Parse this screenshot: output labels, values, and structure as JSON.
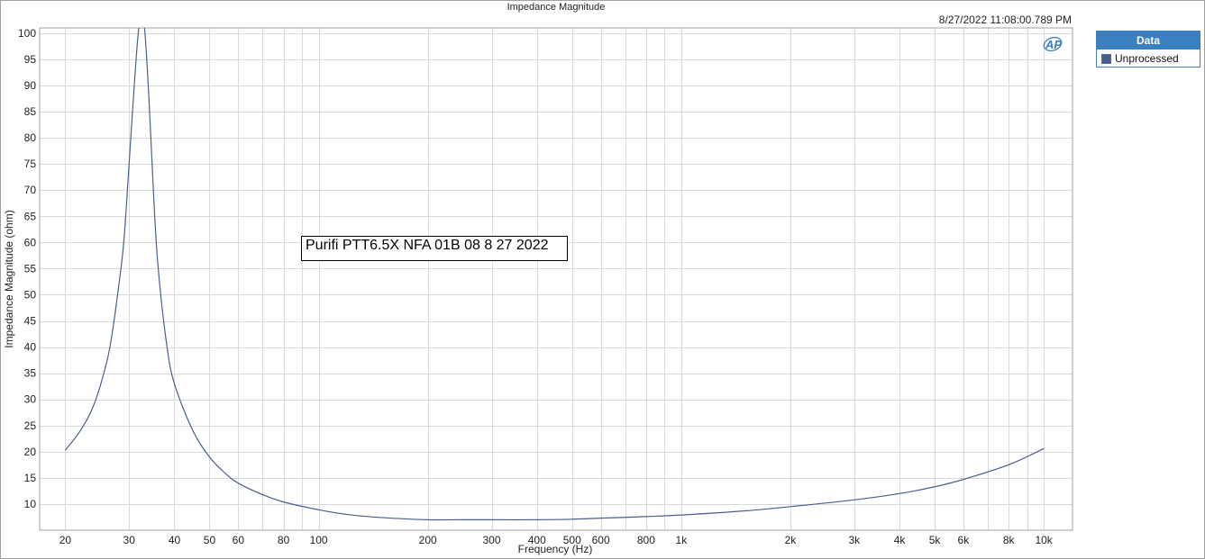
{
  "chart_data": {
    "type": "line",
    "title": "Impedance Magnitude",
    "timestamp": "8/27/2022 11:08:00.789 PM",
    "xlabel": "Frequency (Hz)",
    "ylabel": "Impedance Magnitude (ohm)",
    "x_scale": "log",
    "xlim": [
      17,
      12000
    ],
    "ylim": [
      5,
      101
    ],
    "grid": true,
    "x_ticks": [
      {
        "value": 20,
        "label": "20"
      },
      {
        "value": 30,
        "label": "30"
      },
      {
        "value": 40,
        "label": "40"
      },
      {
        "value": 50,
        "label": "50"
      },
      {
        "value": 60,
        "label": "60"
      },
      {
        "value": 80,
        "label": "80"
      },
      {
        "value": 100,
        "label": "100"
      },
      {
        "value": 200,
        "label": "200"
      },
      {
        "value": 300,
        "label": "300"
      },
      {
        "value": 400,
        "label": "400"
      },
      {
        "value": 500,
        "label": "500"
      },
      {
        "value": 600,
        "label": "600"
      },
      {
        "value": 800,
        "label": "800"
      },
      {
        "value": 1000,
        "label": "1k"
      },
      {
        "value": 2000,
        "label": "2k"
      },
      {
        "value": 3000,
        "label": "3k"
      },
      {
        "value": 4000,
        "label": "4k"
      },
      {
        "value": 5000,
        "label": "5k"
      },
      {
        "value": 6000,
        "label": "6k"
      },
      {
        "value": 8000,
        "label": "8k"
      },
      {
        "value": 10000,
        "label": "10k"
      }
    ],
    "y_ticks": [
      100,
      95,
      90,
      85,
      80,
      75,
      70,
      65,
      60,
      55,
      50,
      45,
      40,
      35,
      30,
      25,
      20,
      15,
      10
    ],
    "legend": {
      "title": "Data",
      "position": "top-right"
    },
    "annotation": "Purifi PTT6.5X NFA 01B 08 8 27 2022",
    "series": [
      {
        "name": "Unprocessed",
        "color": "#4a5f8f",
        "x": [
          20,
          22,
          24,
          26,
          27,
          28,
          29,
          30,
          31,
          32,
          33,
          34,
          35,
          36,
          38,
          40,
          45,
          50,
          55,
          60,
          70,
          80,
          100,
          120,
          150,
          200,
          250,
          300,
          400,
          500,
          600,
          800,
          1000,
          1500,
          2000,
          3000,
          4000,
          5000,
          6000,
          8000,
          10000
        ],
        "y": [
          20.3,
          24,
          29,
          37,
          43,
          51,
          60,
          75,
          90,
          103,
          103,
          88,
          70,
          56,
          41,
          33,
          24,
          19,
          16,
          14,
          11.8,
          10.4,
          8.9,
          8.0,
          7.4,
          7.0,
          7.0,
          7.0,
          7.0,
          7.1,
          7.3,
          7.6,
          7.9,
          8.7,
          9.5,
          10.8,
          12.0,
          13.3,
          14.7,
          17.5,
          20.6
        ]
      }
    ]
  }
}
